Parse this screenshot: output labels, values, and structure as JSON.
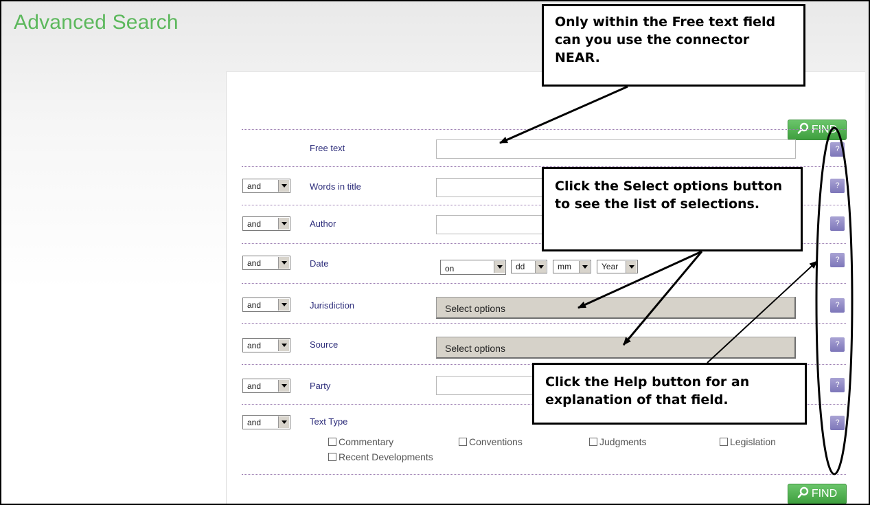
{
  "page": {
    "title": "Advanced Search"
  },
  "find_button": {
    "label": "FIND",
    "icon": "magnifier-icon"
  },
  "fields": [
    {
      "key": "free_text",
      "label": "Free text",
      "connector": "",
      "type": "text"
    },
    {
      "key": "title",
      "label": "Words in title",
      "connector": "and",
      "type": "text"
    },
    {
      "key": "author",
      "label": "Author",
      "connector": "and",
      "type": "text"
    },
    {
      "key": "date",
      "label": "Date",
      "connector": "and",
      "type": "date"
    },
    {
      "key": "jurisdiction",
      "label": "Jurisdiction",
      "connector": "and",
      "type": "options"
    },
    {
      "key": "source",
      "label": "Source",
      "connector": "and",
      "type": "options"
    },
    {
      "key": "party",
      "label": "Party",
      "connector": "and",
      "type": "text"
    },
    {
      "key": "text_type",
      "label": "Text Type",
      "connector": "and",
      "type": "checkboxes"
    }
  ],
  "date_selects": {
    "mode": "on",
    "day": "dd",
    "month": "mm",
    "year": "Year"
  },
  "select_options_label": "Select options",
  "text_types": [
    "Commentary",
    "Conventions",
    "Judgments",
    "Legislation",
    "Recent Developments"
  ],
  "help_label": "?",
  "callouts": {
    "near": "Only within the Free text field can you use the connector NEAR.",
    "select": "Click the Select options button to see the list of selections.",
    "help": "Click the Help button for an explanation of that field."
  },
  "colors": {
    "title_green": "#5cb85c",
    "find_green": "#4caf50",
    "label_blue": "#2c2c7a",
    "help_purple": "#8f88c6"
  }
}
